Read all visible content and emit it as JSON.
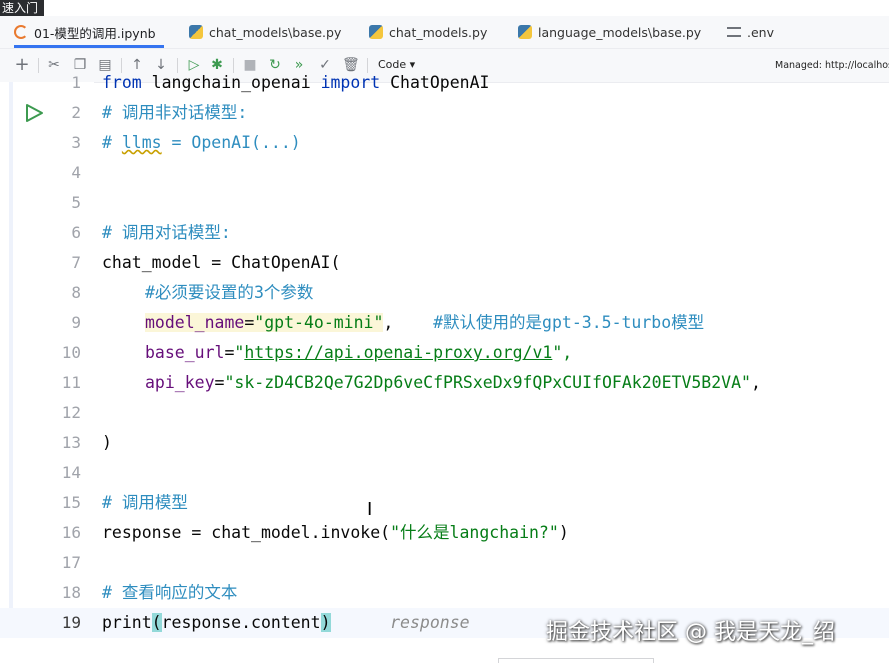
{
  "corner_text": "速入门",
  "tabs": [
    {
      "label": "01-模型的调用.ipynb",
      "icon": "notebook-icon",
      "active": true
    },
    {
      "label": "chat_models\\base.py",
      "icon": "python-file-icon",
      "active": false
    },
    {
      "label": "chat_models.py",
      "icon": "python-file-icon",
      "active": false
    },
    {
      "label": "language_models\\base.py",
      "icon": "python-file-icon",
      "active": false
    },
    {
      "label": ".env",
      "icon": "env-file-icon",
      "active": false
    }
  ],
  "toolbar": {
    "cell_type": "Code",
    "managed_label": "Managed: http://localhost"
  },
  "lines": [
    {
      "n": "1",
      "text": "from langchain_openai import ChatOpenAI"
    },
    {
      "n": "2",
      "text": "# 调用非对话模型:"
    },
    {
      "n": "3",
      "text": "# llms = OpenAI(...)"
    },
    {
      "n": "4",
      "text": ""
    },
    {
      "n": "5",
      "text": ""
    },
    {
      "n": "6",
      "text": "# 调用对话模型:"
    },
    {
      "n": "7",
      "text": "chat_model = ChatOpenAI("
    },
    {
      "n": "8",
      "text": "#必须要设置的3个参数"
    },
    {
      "n": "9",
      "text": "model_name=\"gpt-4o-mini\",    #默认使用的是gpt-3.5-turbo模型"
    },
    {
      "n": "10",
      "text": "base_url=\"https://api.openai-proxy.org/v1\","
    },
    {
      "n": "11",
      "text": "api_key=\"sk-zD4CB2Qe7G2Dp6veCfPRSxeDx9fQPxCUIfOFAk20ETV5B2VA\","
    },
    {
      "n": "12",
      "text": ""
    },
    {
      "n": "13",
      "text": ")"
    },
    {
      "n": "14",
      "text": ""
    },
    {
      "n": "15",
      "text": "# 调用模型"
    },
    {
      "n": "16",
      "text": "response = chat_model.invoke(\"什么是langchain?\")"
    },
    {
      "n": "17",
      "text": ""
    },
    {
      "n": "18",
      "text": "# 查看响应的文本"
    },
    {
      "n": "19",
      "text": "print(response.content)"
    }
  ],
  "code_parts": {
    "l1_from": "from",
    "l1_mod": " langchain_openai ",
    "l1_import": "import",
    "l1_cls": " ChatOpenAI",
    "l2": "# 调用非对话模型:",
    "l3_hash": "# ",
    "l3_llms": "llms",
    "l3_rest": " = OpenAI(...)",
    "l6": "# 调用对话模型:",
    "l7": "chat_model = ChatOpenAI(",
    "l8_hash": "#必须要设置的",
    "l8_num": "3",
    "l8_rest": "个参数",
    "l9_key": "model_name",
    "l9_eq": "=",
    "l9_val": "\"gpt-4o-mini\"",
    "l9_comma": ",    ",
    "l9_c1": "#默认使用的是",
    "l9_c2": "gpt-3.5-turbo",
    "l9_c3": "模型",
    "l10_key": "base_url",
    "l10_eq": "=",
    "l10_q1": "\"",
    "l10_url": "https://api.openai-proxy.org/v1",
    "l10_q2": "\",",
    "l11_key": "api_key",
    "l11_eq": "=",
    "l11_val": "\"sk-zD4CB2Qe7G2Dp6veCfPRSxeDx9fQPxCUIfOFAk20ETV5B2VA\"",
    "l11_comma": ",",
    "l13": ")",
    "l15": "# 调用模型",
    "l16_a": "response = chat_model.invoke(",
    "l16_s1": "\"",
    "l16_zh": "什么是",
    "l16_s2": "langchain?\"",
    "l16_b": ")",
    "l18": "# 查看响应的文本",
    "l19_print": "print",
    "l19_open": "(",
    "l19_mid": "response.content",
    "l19_close": ")",
    "l19_hint": "response"
  },
  "watermark": "掘金技术社区 @ 我是天龙_绍"
}
